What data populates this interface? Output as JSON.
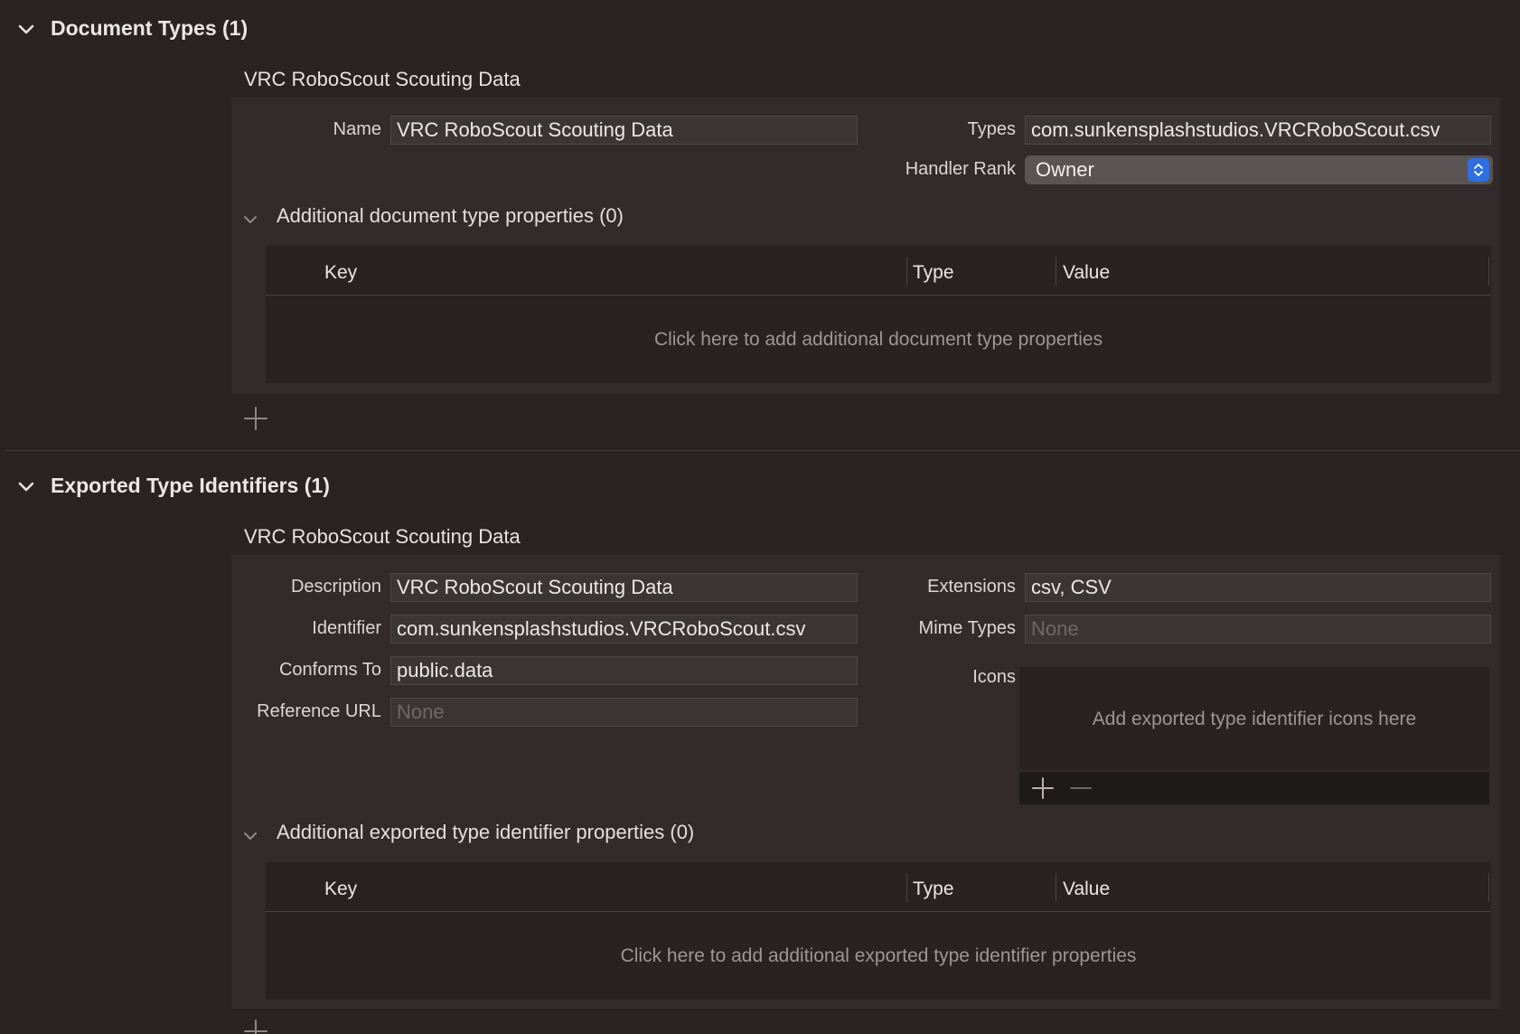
{
  "document_types": {
    "header": "Document Types (1)",
    "entry_title": "VRC RoboScout Scouting Data",
    "name_label": "Name",
    "name_value": "VRC RoboScout Scouting Data",
    "types_label": "Types",
    "types_value": "com.sunkensplashstudios.VRCRoboScout.csv",
    "handler_rank_label": "Handler Rank",
    "handler_rank_value": "Owner",
    "additional_header": "Additional document type properties (0)",
    "table": {
      "columns": [
        "Key",
        "Type",
        "Value"
      ],
      "empty_message": "Click here to add additional document type properties"
    }
  },
  "exported_types": {
    "header": "Exported Type Identifiers (1)",
    "entry_title": "VRC RoboScout Scouting Data",
    "description_label": "Description",
    "description_value": "VRC RoboScout Scouting Data",
    "identifier_label": "Identifier",
    "identifier_value": "com.sunkensplashstudios.VRCRoboScout.csv",
    "conforms_label": "Conforms To",
    "conforms_value": "public.data",
    "reference_url_label": "Reference URL",
    "reference_url_placeholder": "None",
    "extensions_label": "Extensions",
    "extensions_value": "csv, CSV",
    "mime_label": "Mime Types",
    "mime_placeholder": "None",
    "icons_label": "Icons",
    "icons_empty_message": "Add exported type identifier icons here",
    "additional_header": "Additional exported type identifier properties (0)",
    "table": {
      "columns": [
        "Key",
        "Type",
        "Value"
      ],
      "empty_message": "Click here to add additional exported type identifier properties"
    }
  },
  "icons": {
    "section_toggle": "chevron-down-icon",
    "add": "plus-icon",
    "remove": "minus-icon",
    "popup": "up-down-arrows-icon"
  },
  "colors": {
    "background": "#2b2323",
    "panel": "#332b2b",
    "accent": "#2f6fe0"
  }
}
